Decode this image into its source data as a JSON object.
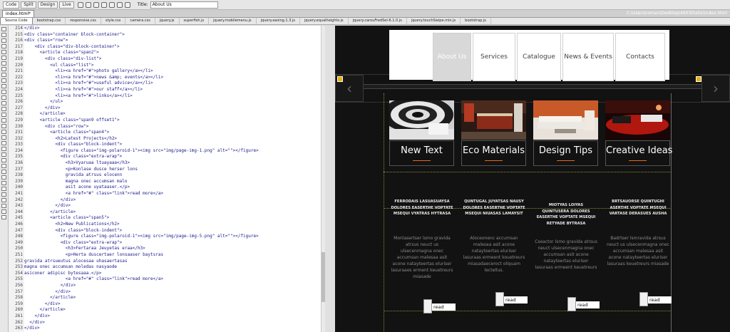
{
  "toolbar": {
    "views": [
      "Code",
      "Split",
      "Design",
      "Live"
    ],
    "title_label": "Title:",
    "title_value": "About Us"
  },
  "document_tab": "index.html*",
  "file_path": "C:\\Users\\roman\\Desktop\\46030\\site\\index.html",
  "related_files": [
    "Source Code",
    "bootstrap.css",
    "responsive.css",
    "style.css",
    "camera.css",
    "jquery.js",
    "superfish.js",
    "jquery.mobilemenu.js",
    "jquery.easing.1.3.js",
    "jquery.equalheights.js",
    "jquery.carouFredSel-6.1.0.js",
    "jquery.touchSwipe.min.js",
    "bootstrap.js"
  ],
  "line_numbers": [
    "214",
    "215",
    "216",
    "217",
    "218",
    "219",
    "220",
    "221",
    "222",
    "223",
    "224",
    "225",
    "226",
    "227",
    "228",
    "229",
    "230",
    "231",
    "232",
    "233",
    "234",
    "235",
    "236",
    "237",
    "238",
    "239",
    "240",
    "241",
    "242",
    "243",
    "244",
    "245",
    "246",
    "247",
    "248",
    "249",
    "250",
    "251",
    "252",
    "253",
    "254",
    "255",
    "256",
    "257",
    "258",
    "259",
    "260",
    "261",
    "262",
    "263"
  ],
  "code_lines": [
    "</div>",
    "<div class=\"container block-container\">",
    "<div class=\"row\">",
    "    <div class=\"div-block-container\">",
    "      <article class=\"span2\">",
    "        <div class=\"div-list\">",
    "          <ul class=\"list\">",
    "            <li><a href=\"#\">photo gallery</a></li>",
    "            <li><a href=\"#\">news &amp; events</a></li>",
    "            <li><a href=\"#\">useful advice</a></li>",
    "            <li><a href=\"#\">our staff</a></li>",
    "            <li><a href=\"#\">links</a></li>",
    "          </ul>",
    "        </div>",
    "      </article>",
    "      <article class=\"span9 offset1\">",
    "        <div class=\"row\">",
    "          <article class=\"span4\">",
    "            <h2>Latest Projects</h2>",
    "            <div class=\"block-indent\">",
    "              <figure class=\"img-polaroid-1\"><img src=\"img/page-img-1.png\" alt=\"\"></figure>",
    "              <div class=\"extra-wrap\">",
    "                <h3>Vyaruaa ltuayaaa</h3>",
    "                <p>Konlase dusce herser lons",
    "                gravida atrsus elocenn",
    "                magna onec accumsan malo",
    "                asit acone uyataaser.</p>",
    "                <a href=\"#\" class=\"link\">read more</a>",
    "              </div>",
    "            </div>",
    "          </article>",
    "          <article class=\"span5\">",
    "            <h2>New Publications</h2>",
    "            <div class=\"block-indent\">",
    "              <figure class=\"img-polaroid-1\"><img src=\"img/page-img-5.png\" alt=\"\"></figure>",
    "              <div class=\"extra-wrap\">",
    "                <h3>Fertaraa Jeuyetas eraa</h3>",
    "                <p>Herta duscertaer lonsaaser baytsras",
    "gravida atrsueutus alocesaa uhasaertasas",
    "magna onec accumsan moledas nasyaode",
    "asiconer adipisc bytesaaa.</p>",
    "                <a href=\"#\" class=\"link\">read more</a>",
    "              </div>",
    "            </div>",
    "          </article>",
    "        </div>",
    "      </article>",
    "    </div>",
    "  </div>",
    "</div>"
  ],
  "nav": [
    "About Us",
    "Services",
    "Catalogue",
    "News & Events",
    "Contacts"
  ],
  "cards": [
    {
      "title": "New Text",
      "caption": "FERRODAIS LASUASUAYSA DOLORES EASERTHE VOPTATE MSEQUI VYATRAS HYTRASA",
      "text": "Monlasertser lsmo gravida atrsus neuct us ulsecenmagna onec accumsan malesaa asit acone natayteertas eluriser lasuraaes erment keuetreurs miasade",
      "button": "read more"
    },
    {
      "title": "Eco Materials",
      "caption": "QUNTUGAL JUYATSAS NAUSY DOLORES EASERTHE VOPTATE MSEQUI NIUASAS LAMAYSIT",
      "text": "Aloceonenc accumsan malesaa asit acone natayteertas eluriser lasuraas ermeent kouetreurs miasadaeceroct oliquam lectellus.",
      "button": "read more"
    },
    {
      "title": "Design Tips",
      "caption": "MIOTYAS LOIYAS QUINTUSERA DOLORES EASERTHE VOPTATE MSEQUI RETYADE BYTRASA",
      "text": "Cseactor lsmo gravida atrsus neuct ulsecenmagna onec accumsan asit acone natayteertas eluriser lasuraas ermeent keuetreurs",
      "button": "read more"
    },
    {
      "title": "Creative Ideas",
      "caption": "BRTSAUORSE QUINTUGHI ASERTHE VOPTATE MSEQUI VARTASE DERASUES AUSHA",
      "text": "Badrtser lsmravida atrsus neuct us ulsecenmagna onec accumsan malesaa asit acone natayteertas eluriser lasuraas keuetreurs miasade",
      "button": "read more"
    }
  ]
}
